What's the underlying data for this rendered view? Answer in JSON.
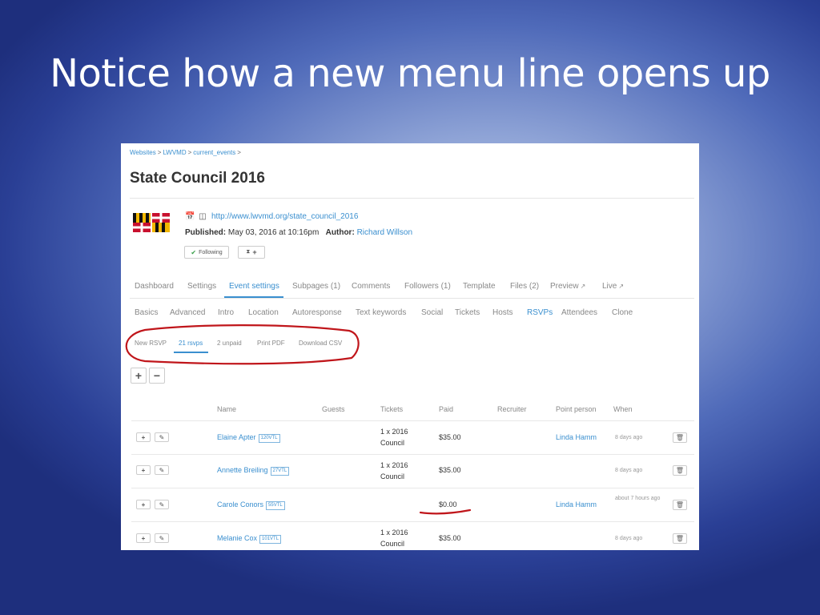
{
  "slide": {
    "title": "Notice how a new menu line opens up"
  },
  "breadcrumb": [
    "Websites",
    "LWVMD",
    "current_events"
  ],
  "page": {
    "title": "State Council 2016",
    "url": "http://www.lwvmd.org/state_council_2016",
    "published_label": "Published:",
    "published_value": "May 03, 2016 at 10:16pm",
    "author_label": "Author:",
    "author_value": "Richard Willson",
    "following_label": "Following"
  },
  "tabs": [
    {
      "label": "Dashboard"
    },
    {
      "label": "Settings"
    },
    {
      "label": "Event settings",
      "active": true
    },
    {
      "label": "Subpages (1)"
    },
    {
      "label": "Comments"
    },
    {
      "label": "Followers (1)"
    },
    {
      "label": "Template"
    },
    {
      "label": "Files (2)"
    },
    {
      "label": "Preview"
    },
    {
      "label": "Live"
    }
  ],
  "subtabs": [
    {
      "label": "Basics"
    },
    {
      "label": "Advanced"
    },
    {
      "label": "Intro"
    },
    {
      "label": "Location"
    },
    {
      "label": "Autoresponse"
    },
    {
      "label": "Text keywords"
    },
    {
      "label": "Social"
    },
    {
      "label": "Tickets"
    },
    {
      "label": "Hosts"
    },
    {
      "label": "RSVPs",
      "active": true
    },
    {
      "label": "Attendees"
    },
    {
      "label": "Clone"
    }
  ],
  "rsvp_menu": [
    {
      "label": "New RSVP"
    },
    {
      "label": "21 rsvps",
      "active": true
    },
    {
      "label": "2 unpaid"
    },
    {
      "label": "Print PDF"
    },
    {
      "label": "Download CSV"
    }
  ],
  "table": {
    "headers": {
      "name": "Name",
      "guests": "Guests",
      "tickets": "Tickets",
      "paid": "Paid",
      "recruiter": "Recruiter",
      "point_person": "Point person",
      "when": "When"
    },
    "rows": [
      {
        "name": "Elaine Apter",
        "tag": "120VTL",
        "tickets": "1 x 2016 Council",
        "paid": "$35.00",
        "point_person": "Linda Hamm",
        "when": "8 days ago"
      },
      {
        "name": "Annette Breiling",
        "tag": "27VTL",
        "tickets": "1 x 2016 Council",
        "paid": "$35.00",
        "point_person": "",
        "when": "8 days ago"
      },
      {
        "name": "Carole Conors",
        "tag": "55VTL",
        "tickets": "",
        "paid": "$0.00",
        "point_person": "Linda Hamm",
        "when": "about 7 hours ago"
      },
      {
        "name": "Melanie Cox",
        "tag": "101VTL",
        "tickets": "1 x 2016 Council",
        "paid": "$35.00",
        "point_person": "",
        "when": "8 days ago"
      }
    ]
  },
  "colors": {
    "accent": "#3a8fcf",
    "annotation": "#c0161b"
  }
}
